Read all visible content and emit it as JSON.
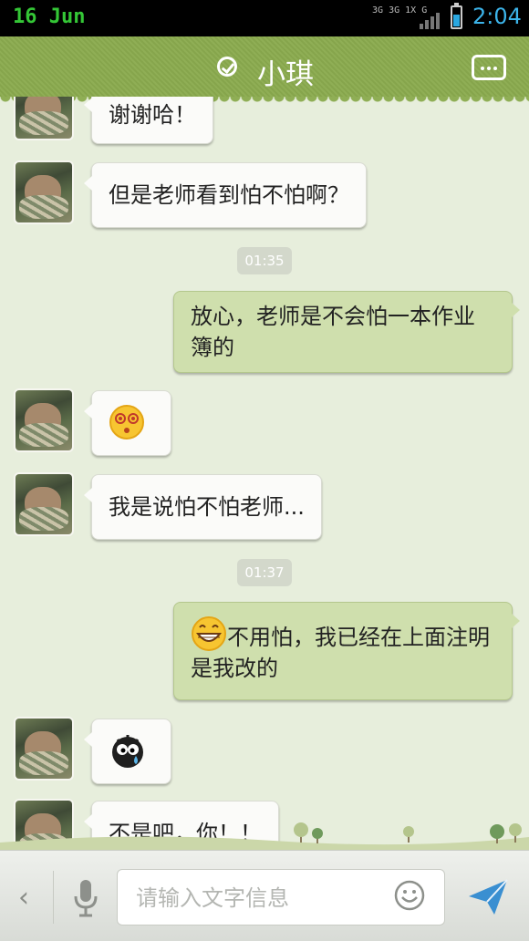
{
  "status_bar": {
    "date": "16 Jun",
    "network": [
      "3G",
      "3G 1X",
      "G"
    ],
    "time": "2:04",
    "battery_level": 0.6
  },
  "header": {
    "title": "小琪",
    "online_icon": "check-circle-icon",
    "menu_icon": "more-dots-icon"
  },
  "messages": [
    {
      "dir": "in",
      "text": "谢谢哈！"
    },
    {
      "dir": "in",
      "text": "但是老师看到怕不怕啊？"
    },
    {
      "type": "time",
      "text": "01:35"
    },
    {
      "dir": "out",
      "text": "放心，老师是不会怕一本作业簿的"
    },
    {
      "dir": "in",
      "emoji": "dizzy-face-emoji"
    },
    {
      "dir": "in",
      "text": "我是说怕不怕老师..."
    },
    {
      "type": "time",
      "text": "01:37"
    },
    {
      "dir": "out",
      "emoji": "grin-face-emoji",
      "text": "不用怕，我已经在上面注明是我改的"
    },
    {
      "dir": "in",
      "emoji": "crying-bug-emoji"
    },
    {
      "dir": "in",
      "text": "不是吧，你！！"
    }
  ],
  "input_bar": {
    "placeholder": "请输入文字信息",
    "value": ""
  },
  "colors": {
    "header": "#8fae55",
    "out_bubble": "#cfdfad",
    "in_bubble": "#fbfbf9",
    "background": "#e7eedc"
  }
}
